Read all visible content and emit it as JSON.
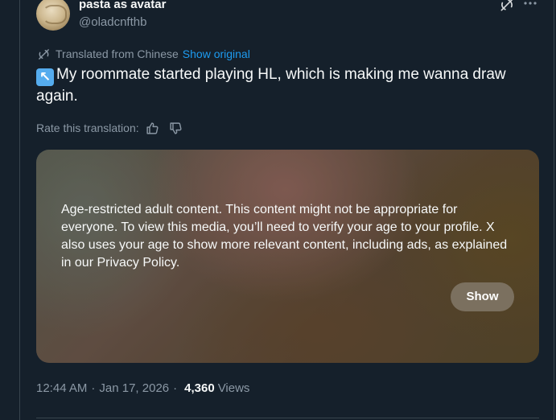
{
  "author": {
    "display_name": "pasta as avatar",
    "handle": "@oladcnfthb",
    "avatar_icon": "avatar-image"
  },
  "header_actions": {
    "grok_icon": "grok-icon",
    "more_icon": "more-icon"
  },
  "translation": {
    "translated_from": "Translated from Chinese",
    "show_original": "Show original",
    "rate_label": "Rate this translation:"
  },
  "tweet": {
    "emoji": "↖",
    "text": "My roommate started playing HL, which is making me wanna draw again."
  },
  "media": {
    "warning": "Age-restricted adult content. This content might not be appropriate for everyone. To view this media, you’ll need to verify your age to your profile. X also uses your age to show more relevant content, including ads, as explained in our Privacy Policy.",
    "show_label": "Show"
  },
  "meta": {
    "time": "12:44 AM",
    "separator1": "·",
    "date": "Jan 17, 2026",
    "separator2": "·",
    "views_count": "4,360",
    "views_label": "Views"
  },
  "colors": {
    "background": "#15202b",
    "text_primary": "#f7f9f9",
    "text_secondary": "#8b98a5",
    "accent": "#1d9bf0"
  }
}
